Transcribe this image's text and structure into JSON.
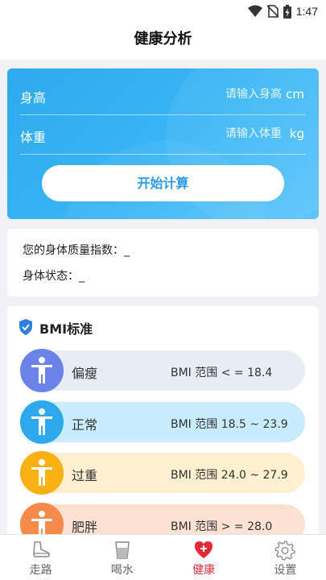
{
  "status_bar": {
    "time": "1:47",
    "icons": [
      "wifi-icon",
      "no-sim-icon",
      "battery-charging-icon"
    ]
  },
  "header": {
    "title": "健康分析"
  },
  "input_card": {
    "height": {
      "label": "身高",
      "placeholder": "请输入身高",
      "unit": "cm"
    },
    "weight": {
      "label": "体重",
      "placeholder": "请输入体重",
      "unit": "kg"
    },
    "start_button": "开始计算"
  },
  "result": {
    "bmi_label": "您的身体质量指数：",
    "bmi_value": "_",
    "state_label": "身体状态：",
    "state_value": "_"
  },
  "bmi_standard": {
    "title": "BMI标准",
    "icon": "shield-check-icon",
    "items": [
      {
        "name": "偏瘦",
        "range": "BMI 范围 < = 18.4",
        "avatar_color": "#6b82e8",
        "bg_color": "#e8ecf4"
      },
      {
        "name": "正常",
        "range": "BMI 范围 18.5 ~ 23.9",
        "avatar_color": "#2ea9ee",
        "bg_color": "#c9ecfc"
      },
      {
        "name": "过重",
        "range": "BMI 范围 24.0 ~ 27.9",
        "avatar_color": "#f8b112",
        "bg_color": "#fdf0d0"
      },
      {
        "name": "肥胖",
        "range": "BMI 范围 > = 28.0",
        "avatar_color": "#f58b4a",
        "bg_color": "#fde2d4"
      }
    ]
  },
  "tabbar": {
    "items": [
      {
        "label": "走路",
        "icon": "shoe-icon",
        "active": false
      },
      {
        "label": "喝水",
        "icon": "cup-icon",
        "active": false
      },
      {
        "label": "健康",
        "icon": "heart-plus-icon",
        "active": true
      },
      {
        "label": "设置",
        "icon": "gear-icon",
        "active": false
      }
    ]
  },
  "colors": {
    "accent": "#2ea9ee",
    "active_tab": "#e22b3a"
  }
}
